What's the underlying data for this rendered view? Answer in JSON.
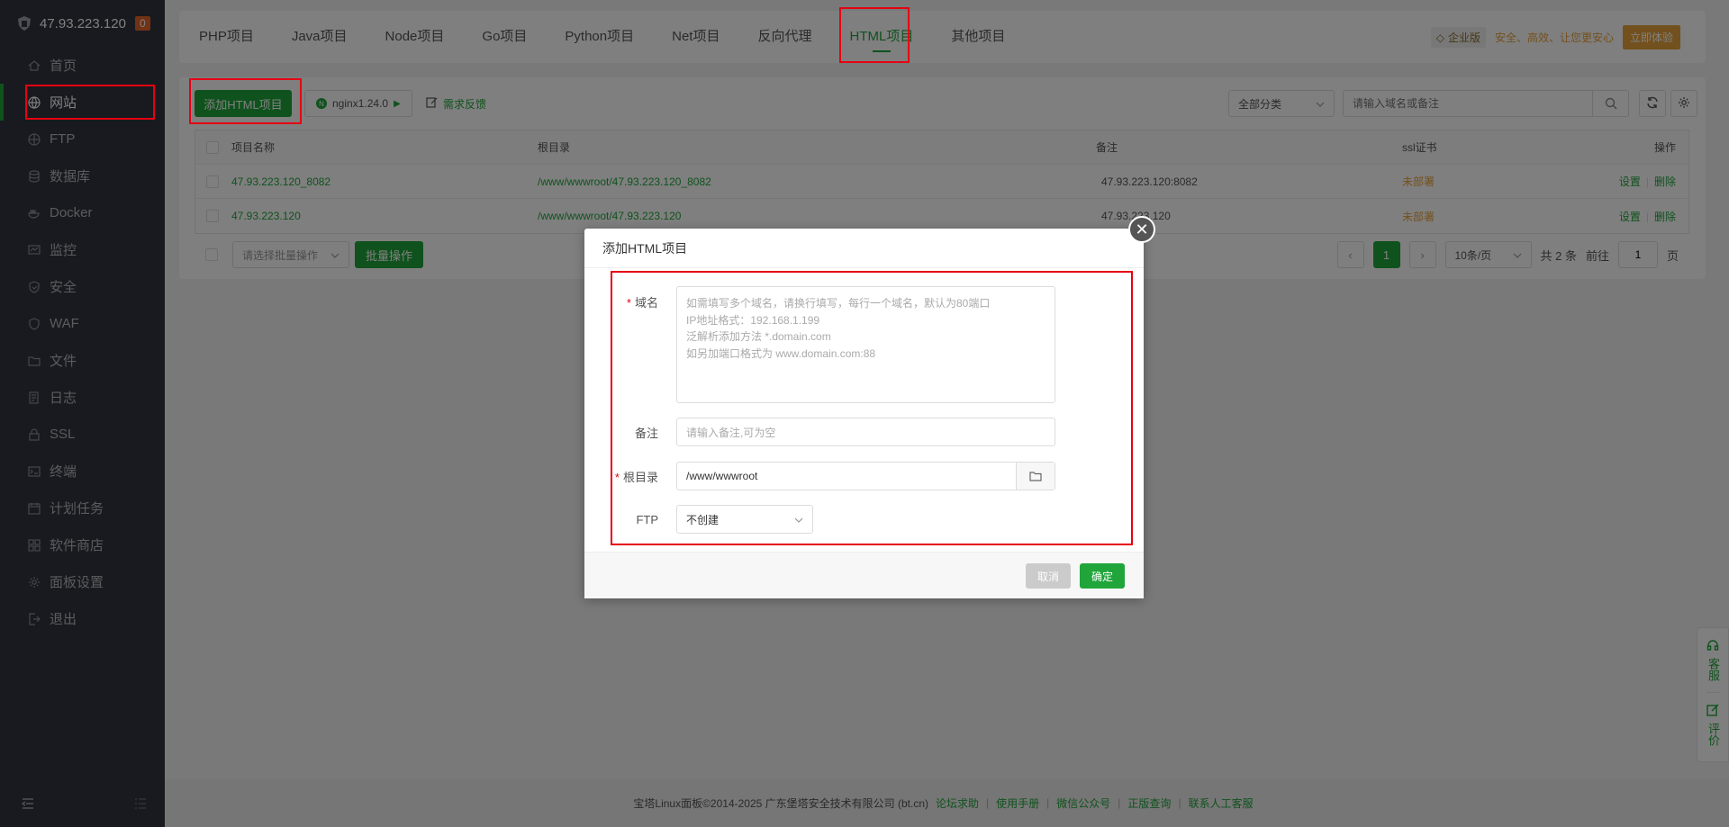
{
  "sidebar": {
    "server_ip": "47.93.223.120",
    "badge": "0",
    "items": [
      {
        "label": "首页",
        "icon": "home-icon"
      },
      {
        "label": "网站",
        "icon": "globe-icon"
      },
      {
        "label": "FTP",
        "icon": "ftp-icon"
      },
      {
        "label": "数据库",
        "icon": "database-icon"
      },
      {
        "label": "Docker",
        "icon": "docker-icon"
      },
      {
        "label": "监控",
        "icon": "monitor-icon"
      },
      {
        "label": "安全",
        "icon": "shield-icon"
      },
      {
        "label": "WAF",
        "icon": "waf-icon"
      },
      {
        "label": "文件",
        "icon": "folder-icon"
      },
      {
        "label": "日志",
        "icon": "log-icon"
      },
      {
        "label": "SSL",
        "icon": "ssl-icon"
      },
      {
        "label": "终端",
        "icon": "terminal-icon"
      },
      {
        "label": "计划任务",
        "icon": "calendar-icon"
      },
      {
        "label": "软件商店",
        "icon": "store-icon"
      },
      {
        "label": "面板设置",
        "icon": "gear-icon"
      },
      {
        "label": "退出",
        "icon": "logout-icon"
      }
    ],
    "active_index": 1
  },
  "tabs": [
    "PHP项目",
    "Java项目",
    "Node项目",
    "Go项目",
    "Python项目",
    "Net项目",
    "反向代理",
    "HTML项目",
    "其他项目"
  ],
  "active_tab": 7,
  "promo": {
    "tag": "企业版",
    "text": "安全、高效、让您更安心",
    "button": "立即体验"
  },
  "toolbar": {
    "add_button": "添加HTML项目",
    "nginx_version": "nginx1.24.0",
    "feedback": "需求反馈",
    "category": "全部分类",
    "search_placeholder": "请输入域名或备注"
  },
  "table": {
    "headers": {
      "name": "项目名称",
      "root": "根目录",
      "note": "备注",
      "ssl": "ssl证书",
      "op": "操作"
    },
    "rows": [
      {
        "name": "47.93.223.120_8082",
        "root": "/www/wwwroot/47.93.223.120_8082",
        "note": "47.93.223.120:8082",
        "ssl": "未部署",
        "set": "设置",
        "del": "删除"
      },
      {
        "name": "47.93.223.120",
        "root": "/www/wwwroot/47.93.223.120",
        "note": "47.93.223.120",
        "ssl": "未部署",
        "set": "设置",
        "del": "删除"
      }
    ]
  },
  "batch": {
    "select_placeholder": "请选择批量操作",
    "button": "批量操作"
  },
  "pagination": {
    "current": "1",
    "page_size": "10条/页",
    "total": "共 2 条",
    "goto_prefix": "前往",
    "goto_value": "1",
    "goto_suffix": "页"
  },
  "modal": {
    "title": "添加HTML项目",
    "domain_label": "域名",
    "domain_placeholder_lines": [
      "如需填写多个域名，请换行填写，每行一个域名，默认为80端口",
      "IP地址格式：192.168.1.199",
      "泛解析添加方法 *.domain.com",
      "如另加端口格式为 www.domain.com:88"
    ],
    "note_label": "备注",
    "note_placeholder": "请输入备注,可为空",
    "root_label": "根目录",
    "root_value": "/www/wwwroot",
    "ftp_label": "FTP",
    "ftp_value": "不创建",
    "cancel": "取消",
    "confirm": "确定"
  },
  "footer": {
    "copyright": "宝塔Linux面板©2014-2025 广东堡塔安全技术有限公司 (bt.cn)",
    "links": [
      "论坛求助",
      "使用手册",
      "微信公众号",
      "正版查询",
      "联系人工客服"
    ]
  },
  "side_tools": [
    "客服",
    "评价"
  ],
  "colors": {
    "accent": "#20a53a",
    "sidebar_bg": "#30353e",
    "warning": "#e6a23c",
    "highlight": "#e60012"
  }
}
